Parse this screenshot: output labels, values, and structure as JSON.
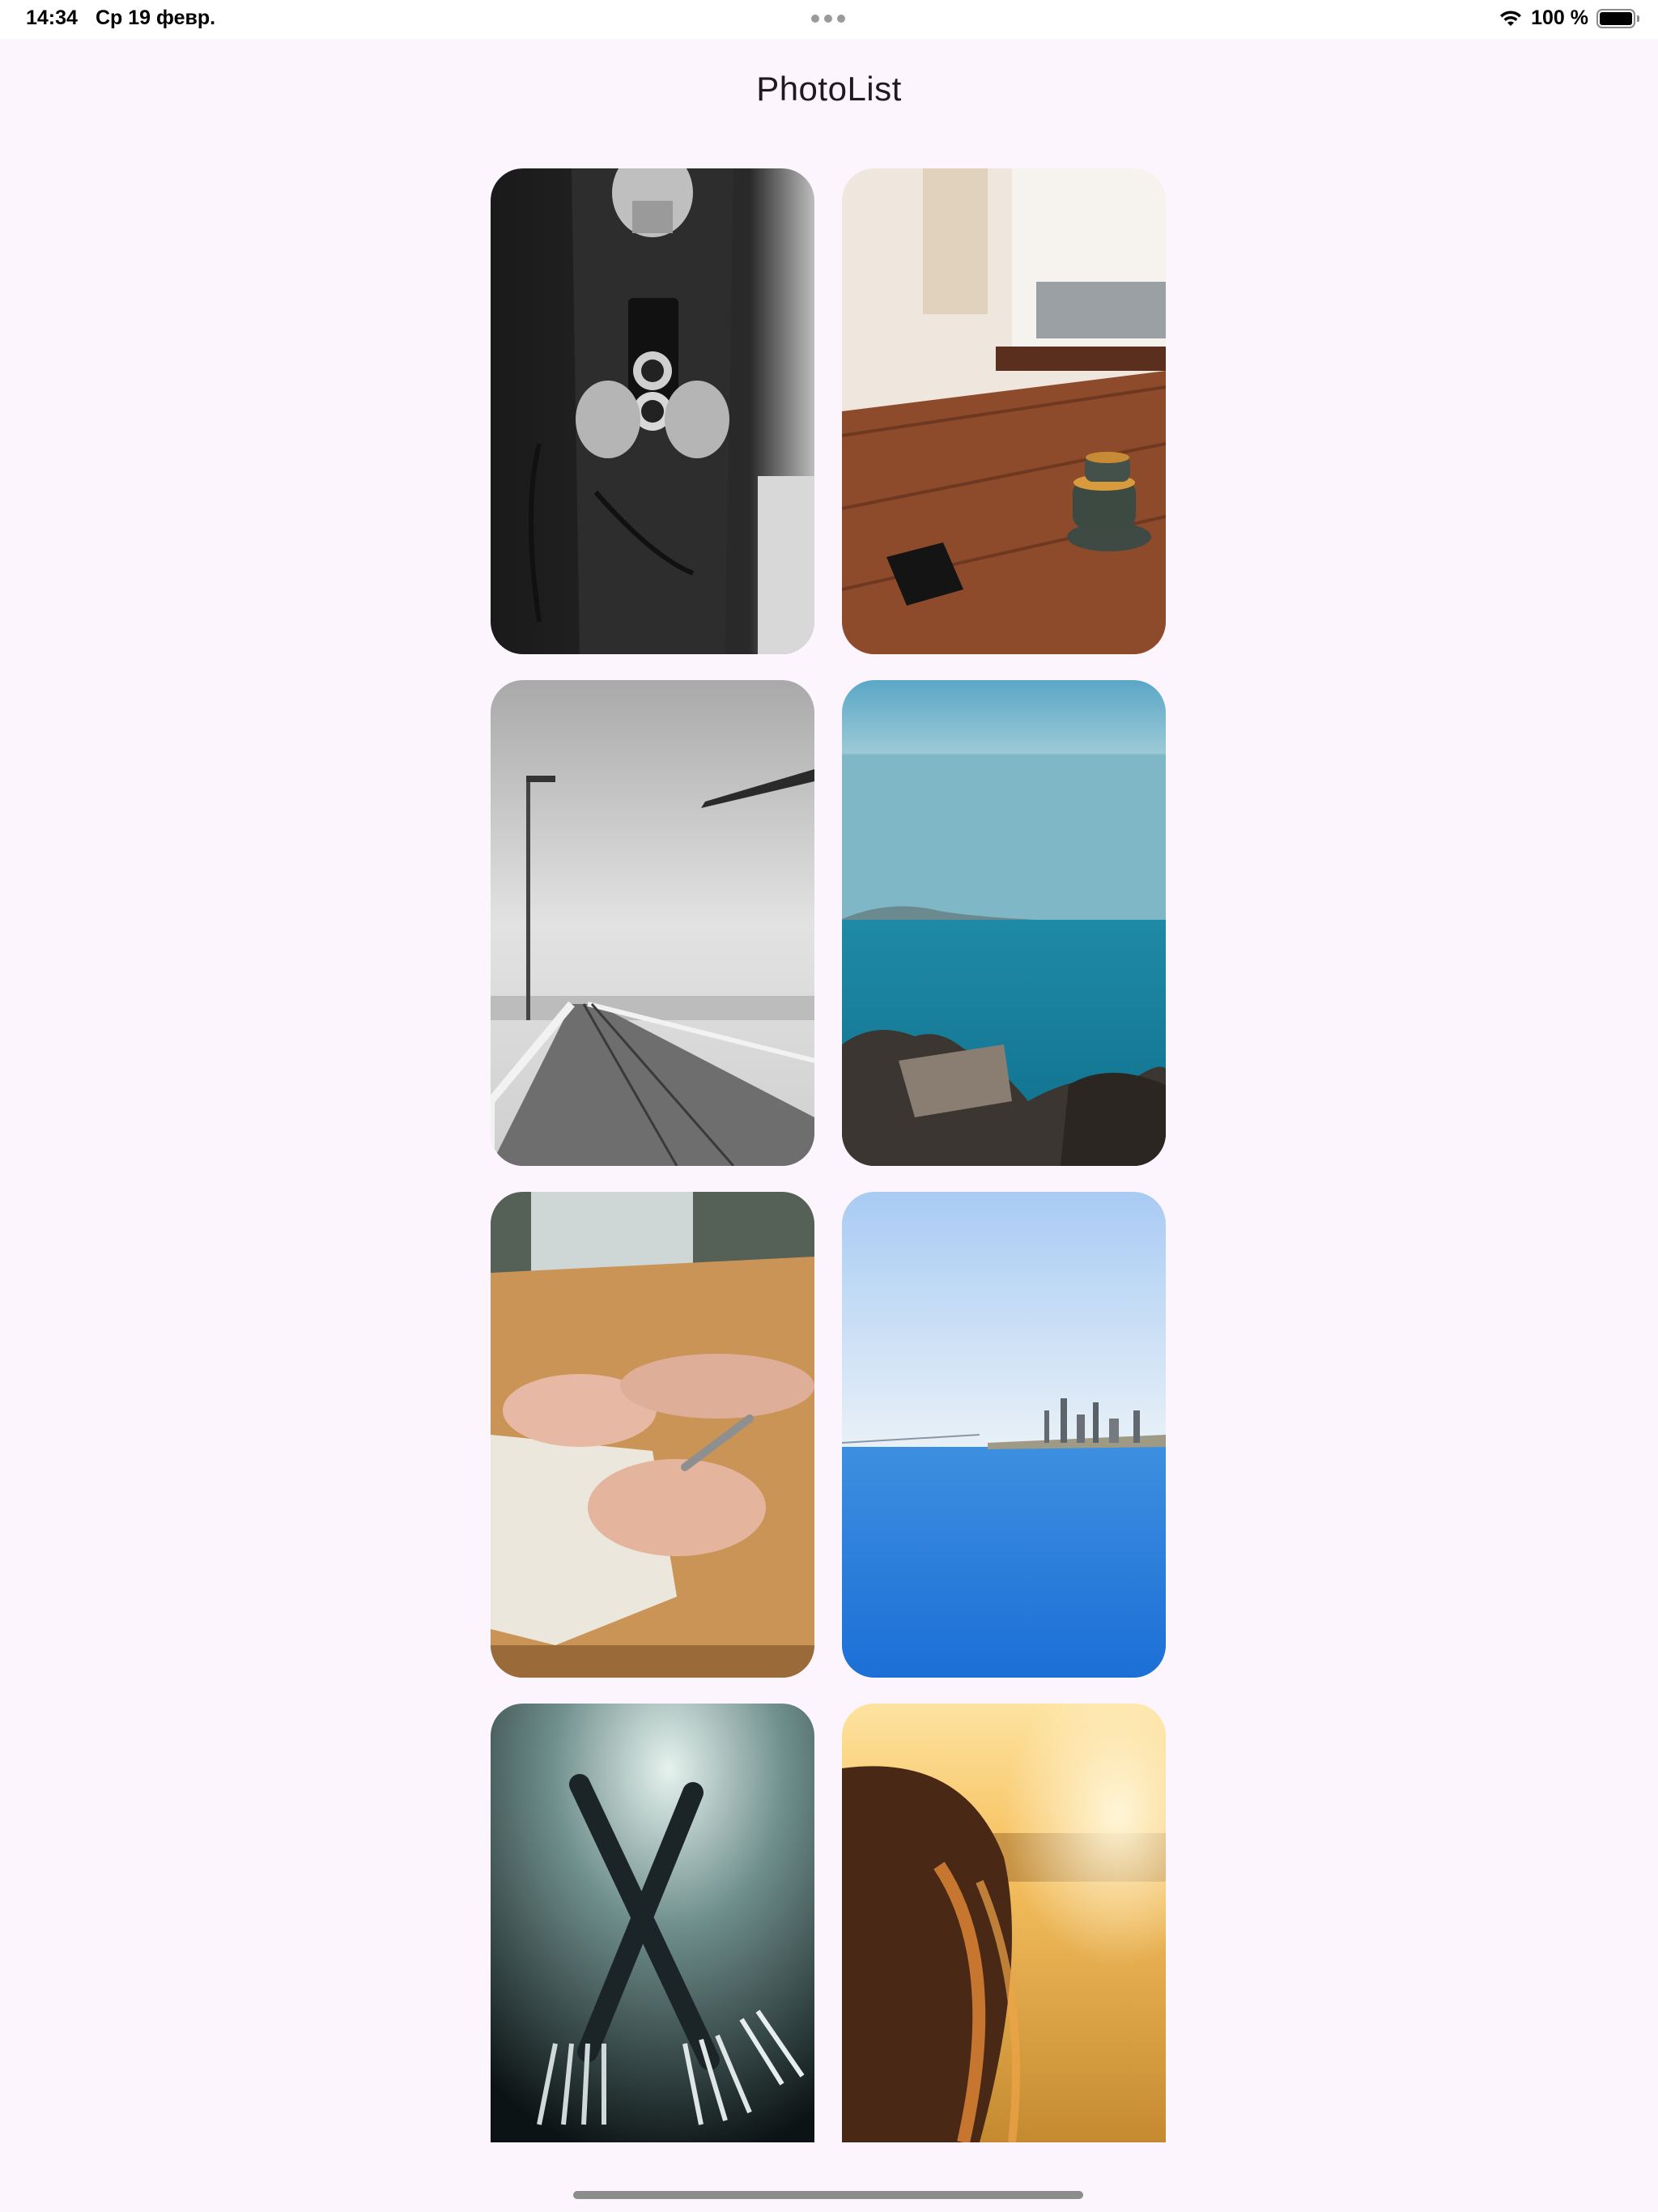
{
  "status_bar": {
    "time": "14:34",
    "date": "Ср 19 февр.",
    "battery": "100 %",
    "icons": [
      "wifi-icon",
      "battery-icon",
      "multitasking-dots-icon"
    ]
  },
  "header": {
    "title": "PhotoList"
  },
  "photos": [
    {
      "subject": "camera-photo"
    },
    {
      "subject": "cafe-table-photo"
    },
    {
      "subject": "pier-photo"
    },
    {
      "subject": "sea-rocks-photo"
    },
    {
      "subject": "writing-hands-photo"
    },
    {
      "subject": "city-sea-photo"
    },
    {
      "subject": "forks-photo"
    },
    {
      "subject": "sunset-hair-photo"
    }
  ],
  "colors": {
    "background": "#fdf5fd",
    "title_text": "#1f1a1f",
    "home_indicator": "#8c8c8c"
  }
}
